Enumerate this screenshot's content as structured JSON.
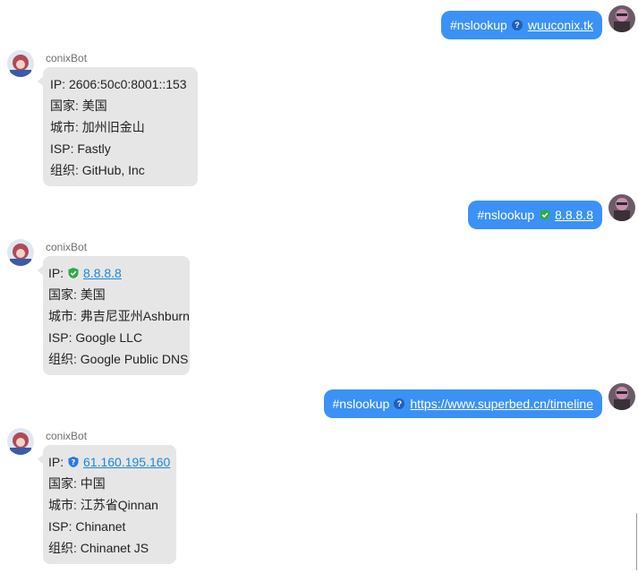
{
  "messages": [
    {
      "type": "user",
      "command": "#nslookup",
      "link": "wuuconix.tk",
      "icon": "question-icon"
    },
    {
      "type": "bot",
      "name": "conixBot",
      "lines": [
        {
          "label": "IP: ",
          "value": "2606:50c0:8001::153"
        },
        {
          "label": "国家: ",
          "value": "美国"
        },
        {
          "label": "城市: ",
          "value": "加州旧金山"
        },
        {
          "label": "ISP: ",
          "value": "Fastly"
        },
        {
          "label": "组织: ",
          "value": "GitHub, Inc"
        }
      ]
    },
    {
      "type": "user",
      "command": "#nslookup",
      "link": "8.8.8.8",
      "icon": "check-shield-icon"
    },
    {
      "type": "bot",
      "name": "conixBot",
      "lines": [
        {
          "label": "IP: ",
          "value": "8.8.8.8",
          "icon": "green-shield-icon"
        },
        {
          "label": "国家: ",
          "value": "美国"
        },
        {
          "label": "城市: ",
          "value": "弗吉尼亚州Ashburn"
        },
        {
          "label": "ISP: ",
          "value": "Google LLC"
        },
        {
          "label": "组织: ",
          "value": "Google Public DNS"
        }
      ]
    },
    {
      "type": "user",
      "command": "#nslookup",
      "link": "https://www.superbed.cn/timeline",
      "icon": "question-icon"
    },
    {
      "type": "bot",
      "name": "conixBot",
      "lines": [
        {
          "label": "IP: ",
          "value": "61.160.195.160",
          "icon": "blue-shield-icon"
        },
        {
          "label": "国家: ",
          "value": "中国"
        },
        {
          "label": "城市: ",
          "value": "江苏省Qinnan"
        },
        {
          "label": "ISP: ",
          "value": "Chinanet"
        },
        {
          "label": "组织: ",
          "value": "Chinanet JS"
        }
      ]
    }
  ],
  "colors": {
    "user_bubble": "#3b91f5",
    "bot_bubble": "#e6e6e6",
    "link": "#1d86d9",
    "shield_green": "#2eaa4a",
    "shield_blue": "#2a7be0"
  }
}
